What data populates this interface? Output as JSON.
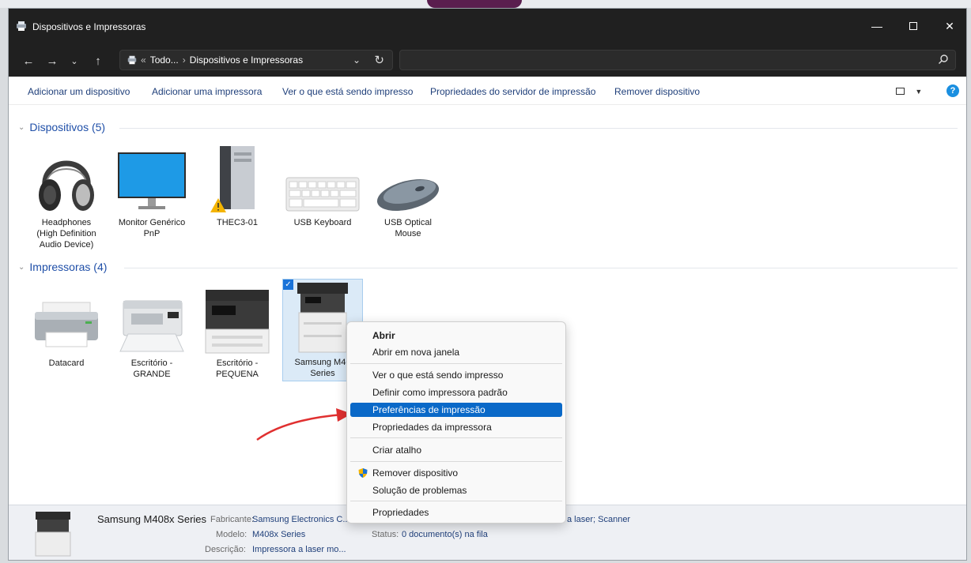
{
  "window": {
    "title": "Dispositivos e Impressoras"
  },
  "address": {
    "prefix": "«",
    "crumb1": "Todo...",
    "separator": "›",
    "crumb2": "Dispositivos e Impressoras"
  },
  "commands": [
    "Adicionar um dispositivo",
    "Adicionar uma impressora",
    "Ver o que está sendo impresso",
    "Propriedades do servidor de impressão",
    "Remover dispositivo"
  ],
  "groups": {
    "devices": {
      "header": "Dispositivos (5)",
      "items": [
        {
          "line1": "Headphones",
          "line2": "(High Definition",
          "line3": "Audio Device)",
          "icon": "headphones-icon"
        },
        {
          "line1": "Monitor Genérico",
          "line2": "PnP",
          "icon": "monitor-icon"
        },
        {
          "line1": "THEC3-01",
          "icon": "computer-icon"
        },
        {
          "line1": "USB Keyboard",
          "icon": "keyboard-icon"
        },
        {
          "line1": "USB Optical",
          "line2": "Mouse",
          "icon": "mouse-icon"
        }
      ]
    },
    "printers": {
      "header": "Impressoras (4)",
      "items": [
        {
          "line1": "Datacard",
          "icon": "printer-icon"
        },
        {
          "line1": "Escritório -",
          "line2": "GRANDE",
          "icon": "printer-icon"
        },
        {
          "line1": "Escritório -",
          "line2": "PEQUENA",
          "icon": "printer-icon"
        },
        {
          "line1": "Samsung M40",
          "line2": "Series",
          "icon": "printer-icon"
        }
      ]
    }
  },
  "context_menu": {
    "items": [
      "Abrir",
      "Abrir em nova janela",
      "Ver o que está sendo impresso",
      "Definir como impressora padrão",
      "Preferências de impressão",
      "Propriedades da impressora",
      "Criar atalho",
      "Remover dispositivo",
      "Solução de problemas",
      "Propriedades"
    ],
    "highlighted": "Preferências de impressão"
  },
  "details": {
    "name": "Samsung M408x Series",
    "fabricante_label": "Fabricante:",
    "fabricante_value": "Samsung Electronics C...",
    "modelo_label": "Modelo:",
    "modelo_value": "M408x Series",
    "descricao_label": "Descrição:",
    "descricao_value": "Impressora a laser mo...",
    "status_label": "Status:",
    "status_value": "0 documento(s) na fila",
    "categoria_value": "a laser; Scanner"
  },
  "colors": {
    "titlebar": "#202020",
    "link": "#1f3f7a",
    "group_header": "#1f4fa8",
    "highlight": "#0a69c8",
    "annotation_arrow": "#e03030"
  }
}
